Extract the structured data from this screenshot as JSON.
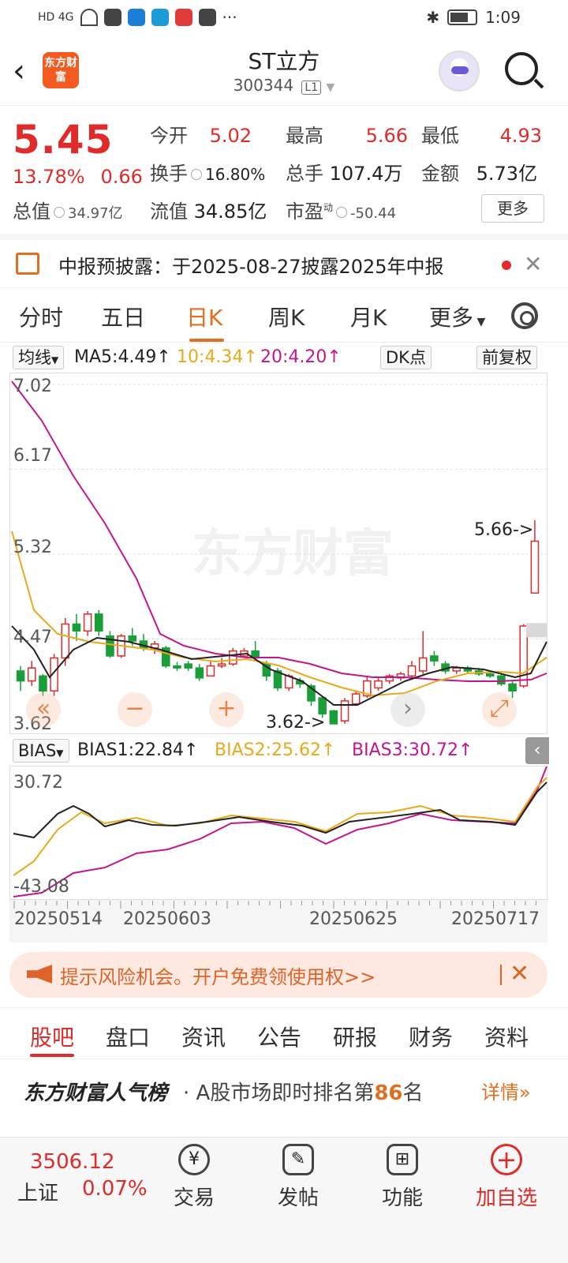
{
  "status_bar": {
    "left_text": "HD 4G",
    "time": "1:09"
  },
  "header": {
    "back": "‹",
    "logo_text": "东方财富",
    "title": "ST立方",
    "code": "300344",
    "level": "L1"
  },
  "quote": {
    "price": "5.45",
    "change_pct": "13.78%",
    "change_amt": "0.66",
    "open_label": "今开",
    "open": "5.02",
    "high_label": "最高",
    "high": "5.66",
    "low_label": "最低",
    "low": "4.93",
    "turnover_label": "换手",
    "turnover": "16.80%",
    "volume_label": "总手",
    "volume": "107.4万",
    "amount_label": "金额",
    "amount": "5.73亿",
    "mktcap_label": "总值",
    "mktcap": "34.97亿",
    "float_label": "流值",
    "float_cap": "34.85亿",
    "pe_label": "市盈",
    "pe_sup": "动",
    "pe": "-50.44",
    "more": "更多"
  },
  "notice": {
    "text": "中报预披露：于2025-08-27披露2025年中报",
    "close": "✕"
  },
  "period_tabs": [
    "分时",
    "五日",
    "日K",
    "周K",
    "月K",
    "更多"
  ],
  "ma_bar": {
    "selector": "均线",
    "ma5": "MA5:4.49↑",
    "ma10": "10:4.34↑",
    "ma20": "20:4.20↑",
    "dk": "DK点",
    "adj": "前复权"
  },
  "kchart": {
    "y_labels": [
      "7.02",
      "6.17",
      "5.32",
      "4.47",
      "3.62"
    ],
    "high_marker": "5.66->",
    "low_marker": "3.62->",
    "watermark": "东方财富"
  },
  "bias_bar": {
    "selector": "BIAS",
    "bias1": "BIAS1:22.84↑",
    "bias2": "BIAS2:25.62↑",
    "bias3": "BIAS3:30.72↑"
  },
  "bias_chart": {
    "top": "30.72",
    "bottom": "-43.08"
  },
  "dates": [
    "20250514",
    "20250603",
    "20250625",
    "20250717"
  ],
  "ad": {
    "text": "提示风险机会。开户免费领使用权>>",
    "close": "✕"
  },
  "community_tabs": [
    "股吧",
    "盘口",
    "资讯",
    "公告",
    "研报",
    "财务",
    "资料"
  ],
  "rank": {
    "brand": "东方财富人气榜",
    "text_pre": "A股市场即时排名第",
    "num": "86",
    "text_post": "名",
    "detail": "详情»"
  },
  "bottom_bar": {
    "index_value": "3506.12",
    "index_name": "上证",
    "index_pct": "0.07%",
    "nav": [
      "交易",
      "发帖",
      "功能",
      "加自选"
    ]
  },
  "colors": {
    "up": "#e02b2b",
    "down": "#1a9e3a",
    "accent": "#e06f1f",
    "ma5": "#222222",
    "ma10": "#e8a91a",
    "ma20": "#c2168f"
  },
  "chart_data": {
    "type": "candlestick",
    "ylim": [
      3.62,
      7.02
    ],
    "candles": [
      {
        "o": 4.15,
        "c": 4.05,
        "h": 4.2,
        "l": 3.95
      },
      {
        "o": 4.05,
        "c": 4.18,
        "h": 4.25,
        "l": 4.0
      },
      {
        "o": 4.1,
        "c": 3.95,
        "h": 4.12,
        "l": 3.9
      },
      {
        "o": 3.95,
        "c": 4.28,
        "h": 4.32,
        "l": 3.9
      },
      {
        "o": 4.28,
        "c": 4.62,
        "h": 4.68,
        "l": 4.2
      },
      {
        "o": 4.62,
        "c": 4.55,
        "h": 4.72,
        "l": 4.45
      },
      {
        "o": 4.55,
        "c": 4.72,
        "h": 4.75,
        "l": 4.5
      },
      {
        "o": 4.72,
        "c": 4.55,
        "h": 4.76,
        "l": 4.5
      },
      {
        "o": 4.5,
        "c": 4.3,
        "h": 4.55,
        "l": 4.28
      },
      {
        "o": 4.3,
        "c": 4.5,
        "h": 4.52,
        "l": 4.28
      },
      {
        "o": 4.5,
        "c": 4.45,
        "h": 4.58,
        "l": 4.4
      },
      {
        "o": 4.45,
        "c": 4.38,
        "h": 4.52,
        "l": 4.35
      },
      {
        "o": 4.38,
        "c": 4.42,
        "h": 4.45,
        "l": 4.32
      },
      {
        "o": 4.38,
        "c": 4.2,
        "h": 4.4,
        "l": 4.18
      },
      {
        "o": 4.2,
        "c": 4.18,
        "h": 4.24,
        "l": 4.15
      },
      {
        "o": 4.22,
        "c": 4.18,
        "h": 4.25,
        "l": 4.15
      },
      {
        "o": 4.18,
        "c": 4.08,
        "h": 4.22,
        "l": 4.05
      },
      {
        "o": 4.1,
        "c": 4.2,
        "h": 4.25,
        "l": 4.1
      },
      {
        "o": 4.2,
        "c": 4.22,
        "h": 4.28,
        "l": 4.18
      },
      {
        "o": 4.22,
        "c": 4.35,
        "h": 4.38,
        "l": 4.2
      },
      {
        "o": 4.3,
        "c": 4.35,
        "h": 4.38,
        "l": 4.28
      },
      {
        "o": 4.35,
        "c": 4.28,
        "h": 4.45,
        "l": 4.25
      },
      {
        "o": 4.22,
        "c": 4.1,
        "h": 4.25,
        "l": 4.05
      },
      {
        "o": 4.15,
        "c": 3.98,
        "h": 4.18,
        "l": 3.95
      },
      {
        "o": 3.98,
        "c": 4.1,
        "h": 4.12,
        "l": 3.95
      },
      {
        "o": 4.05,
        "c": 4.02,
        "h": 4.08,
        "l": 3.98
      },
      {
        "o": 4.0,
        "c": 3.85,
        "h": 4.02,
        "l": 3.8
      },
      {
        "o": 3.88,
        "c": 3.72,
        "h": 3.9,
        "l": 3.68
      },
      {
        "o": 3.75,
        "c": 3.62,
        "h": 3.76,
        "l": 3.62
      },
      {
        "o": 3.65,
        "c": 3.85,
        "h": 3.88,
        "l": 3.62
      },
      {
        "o": 3.82,
        "c": 3.92,
        "h": 3.95,
        "l": 3.8
      },
      {
        "o": 3.9,
        "c": 4.05,
        "h": 4.1,
        "l": 3.88
      },
      {
        "o": 3.98,
        "c": 4.05,
        "h": 4.08,
        "l": 3.95
      },
      {
        "o": 4.05,
        "c": 4.1,
        "h": 4.12,
        "l": 4.02
      },
      {
        "o": 4.08,
        "c": 4.12,
        "h": 4.14,
        "l": 4.05
      },
      {
        "o": 4.1,
        "c": 4.2,
        "h": 4.25,
        "l": 4.08
      },
      {
        "o": 4.15,
        "c": 4.28,
        "h": 4.55,
        "l": 4.12
      },
      {
        "o": 4.3,
        "c": 4.25,
        "h": 4.35,
        "l": 4.2
      },
      {
        "o": 4.22,
        "c": 4.15,
        "h": 4.25,
        "l": 4.12
      },
      {
        "o": 4.15,
        "c": 4.18,
        "h": 4.2,
        "l": 4.12
      },
      {
        "o": 4.18,
        "c": 4.15,
        "h": 4.2,
        "l": 4.12
      },
      {
        "o": 4.15,
        "c": 4.12,
        "h": 4.18,
        "l": 4.1
      },
      {
        "o": 4.12,
        "c": 4.1,
        "h": 4.15,
        "l": 4.08
      },
      {
        "o": 4.1,
        "c": 4.02,
        "h": 4.12,
        "l": 4.0
      },
      {
        "o": 4.02,
        "c": 3.95,
        "h": 4.05,
        "l": 3.88
      },
      {
        "o": 4.0,
        "c": 4.6,
        "h": 4.62,
        "l": 3.98
      },
      {
        "o": 4.93,
        "c": 5.45,
        "h": 5.66,
        "l": 4.93
      }
    ]
  }
}
